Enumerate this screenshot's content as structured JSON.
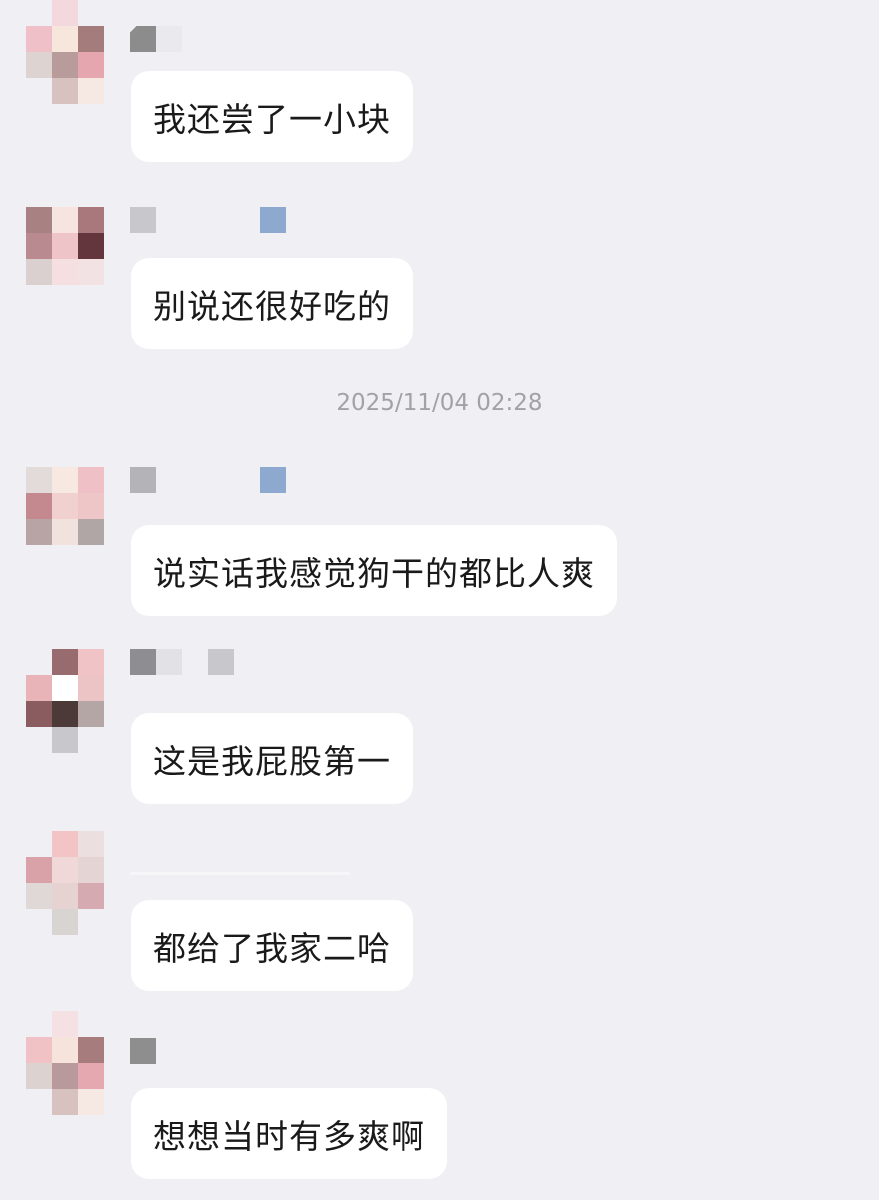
{
  "chat": {
    "timestamp": "2025/11/04 02:28",
    "messages": [
      {
        "sender": "",
        "text": "我还尝了一小块"
      },
      {
        "sender": "",
        "text": "别说还很好吃的"
      },
      {
        "sender": "",
        "text": "说实话我感觉狗干的都比人爽"
      },
      {
        "sender": "",
        "text": "这是我屁股第一"
      },
      {
        "sender": "",
        "text": "都给了我家二哈"
      },
      {
        "sender": "",
        "text": "想想当时有多爽啊"
      }
    ]
  },
  "colors": {
    "background": "#efeff4",
    "bubble": "#ffffff",
    "text": "#1a1a1a",
    "timestamp": "#a1a1a6"
  }
}
